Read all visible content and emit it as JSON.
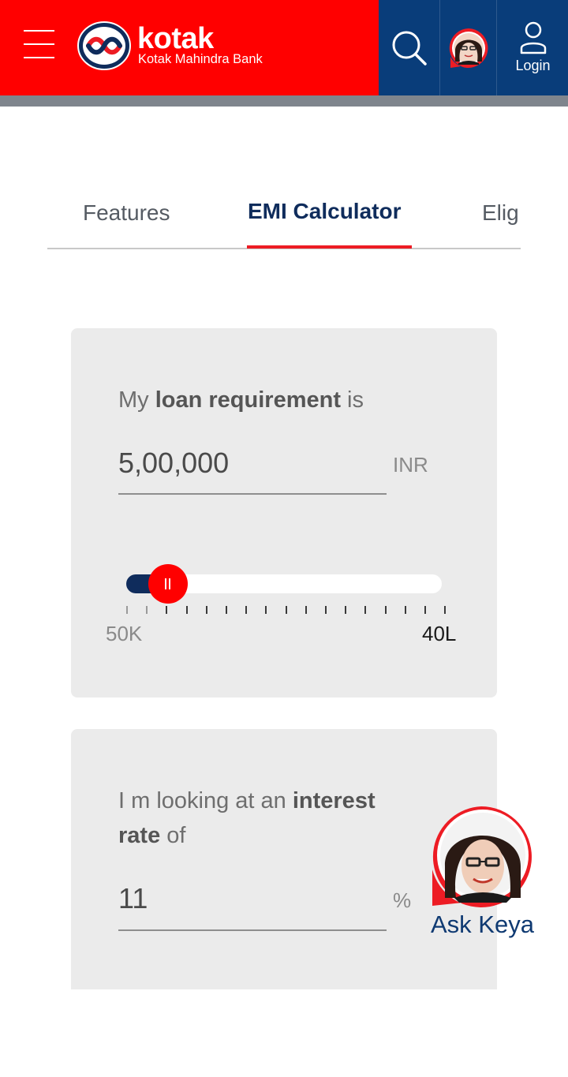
{
  "header": {
    "menu_icon": "hamburger-menu-icon",
    "brand_name": "kotak",
    "brand_subtitle": "Kotak Mahindra Bank",
    "search_icon": "search-icon",
    "assistant_icon": "keya-avatar-icon",
    "login_icon": "user-icon",
    "login_label": "Login",
    "colors": {
      "red": "#ff0000",
      "navy": "#093d7a"
    }
  },
  "tabs": {
    "items": [
      {
        "label": "Features"
      },
      {
        "label": "EMI Calculator",
        "active": true
      },
      {
        "label": "Elig"
      }
    ],
    "accent": "#ed1c24"
  },
  "loan_card": {
    "label_prefix": "My ",
    "label_bold": "loan requirement",
    "label_suffix": " is",
    "value": "5,00,000",
    "unit": "INR",
    "slider": {
      "min_label": "50K",
      "max_label": "40L",
      "min": 50000,
      "max": 4000000,
      "value": 500000
    }
  },
  "rate_card": {
    "label_prefix": "I m looking at an ",
    "label_bold": "interest rate",
    "label_suffix": " of",
    "value": "11",
    "unit": "%"
  },
  "assistant": {
    "label": "Ask Keya",
    "icon": "keya-avatar-icon"
  }
}
